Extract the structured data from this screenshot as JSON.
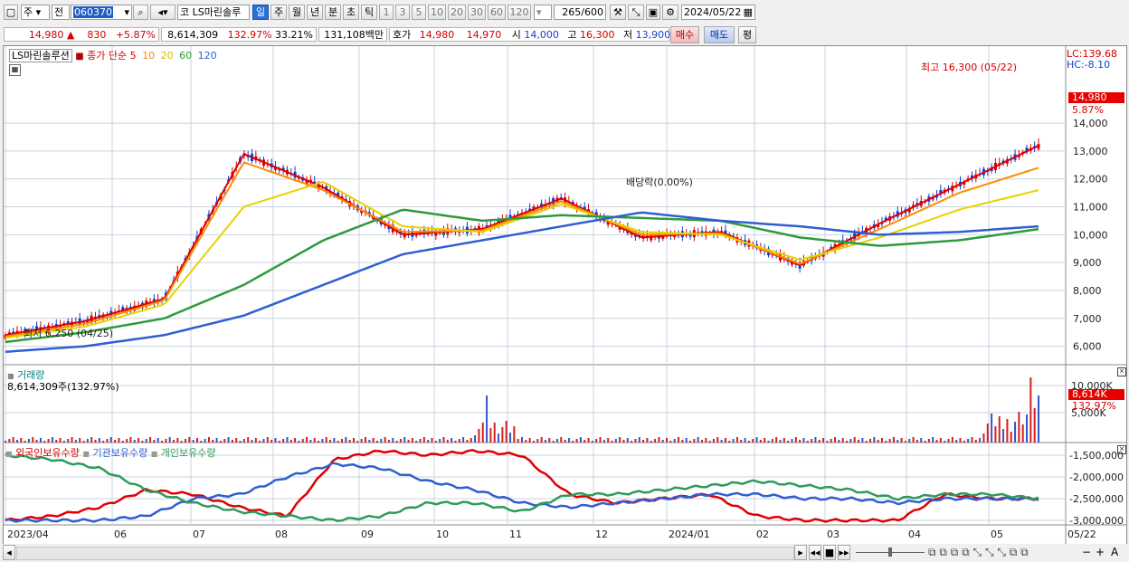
{
  "toolbar": {
    "market": "주",
    "prev": "전",
    "code": "060370",
    "market_tag": "코",
    "stock_name": "LS마린솔루",
    "periods": [
      "일",
      "주",
      "월",
      "년",
      "분",
      "초",
      "틱"
    ],
    "selected_period": "일",
    "ranges": [
      "1",
      "3",
      "5",
      "10",
      "20",
      "30",
      "60",
      "120"
    ],
    "count": "265",
    "count_total": "/600",
    "date": "2024/05/22"
  },
  "quote": {
    "price": "14,980",
    "arrow": "▲",
    "change": "830",
    "change_pct": "+5.87%",
    "volume": "8,614,309",
    "volume_ratio": "132.97%",
    "turnover": "33.21%",
    "amount": "131,108백만",
    "hoga_label": "호가",
    "ask": "14,980",
    "bid": "14,970",
    "open_label": "시",
    "open": "14,000",
    "high_label": "고",
    "high": "16,300",
    "low_label": "저",
    "low": "13,900",
    "buy_label": "매수",
    "sell_label": "매도",
    "avg_label": "평"
  },
  "price_panel": {
    "title": "LS마린솔루션",
    "legend_close": "종가 단순",
    "ma": [
      {
        "label": "5",
        "color": "#e00000"
      },
      {
        "label": "10",
        "color": "#ff8c00"
      },
      {
        "label": "20",
        "color": "#e6d200"
      },
      {
        "label": "60",
        "color": "#2e9a3c"
      },
      {
        "label": "120",
        "color": "#2f5fd0"
      }
    ],
    "lc": "LC:139.68",
    "hc": "HC:-8.10",
    "high_note": "최고 16,300 (05/22)",
    "low_note": "최저 6,250 (04/25)",
    "dividend_note": "배당락(0.00%)",
    "last_price": "14,980",
    "last_pct": "5.87%",
    "y_ticks": [
      "14,000",
      "13,000",
      "12,000",
      "11,000",
      "10,000",
      "9,000",
      "8,000",
      "7,000",
      "6,000"
    ]
  },
  "volume_panel": {
    "title": "거래량",
    "value": "8,614,309주(132.97%)",
    "last_value": "8,614K",
    "last_pct": "132.97%",
    "y_ticks": [
      "10,000K",
      "5,000K"
    ]
  },
  "holding_panel": {
    "series": [
      {
        "label": "외국인보유수량",
        "color": "#e00000"
      },
      {
        "label": "기관보유수량",
        "color": "#2f5fd0"
      },
      {
        "label": "개인보유수량",
        "color": "#2e9a5c"
      }
    ],
    "y_ticks": [
      "-1,500,000",
      "-2,000,000",
      "-2,500,000",
      "-3,000,000"
    ]
  },
  "x_axis": [
    "2023/04",
    "06",
    "07",
    "08",
    "09",
    "10",
    "11",
    "12",
    "2024/01",
    "02",
    "03",
    "04",
    "05",
    "05/22"
  ],
  "chart_data": {
    "type": "line",
    "title": "LS마린솔루션",
    "x": [
      "2023/04",
      "06",
      "07",
      "08",
      "09",
      "10",
      "11",
      "12",
      "2024/01",
      "02",
      "03",
      "04",
      "05",
      "05/22"
    ],
    "series": [
      {
        "name": "5",
        "values": [
          6400,
          6900,
          7700,
          12900,
          11700,
          10000,
          10200,
          11300,
          9900,
          10100,
          8900,
          10400,
          11800,
          13200
        ]
      },
      {
        "name": "10",
        "values": [
          6350,
          6800,
          7650,
          12600,
          11600,
          10100,
          10150,
          11200,
          10000,
          10050,
          8950,
          10200,
          11500,
          12400
        ]
      },
      {
        "name": "20",
        "values": [
          6300,
          6700,
          7500,
          11000,
          11900,
          10300,
          10100,
          11100,
          10100,
          10000,
          9100,
          9900,
          10900,
          11600
        ]
      },
      {
        "name": "60",
        "values": [
          6150,
          6500,
          7000,
          8200,
          9800,
          10900,
          10500,
          10700,
          10600,
          10500,
          9900,
          9600,
          9800,
          10200
        ]
      },
      {
        "name": "120",
        "values": [
          5800,
          6000,
          6400,
          7100,
          8200,
          9300,
          9800,
          10300,
          10800,
          10500,
          10300,
          10000,
          10100,
          10300
        ]
      }
    ],
    "ylim": [
      5500,
      16600
    ],
    "y_ticks": [
      6000,
      7000,
      8000,
      9000,
      10000,
      11000,
      12000,
      13000,
      14000
    ]
  }
}
